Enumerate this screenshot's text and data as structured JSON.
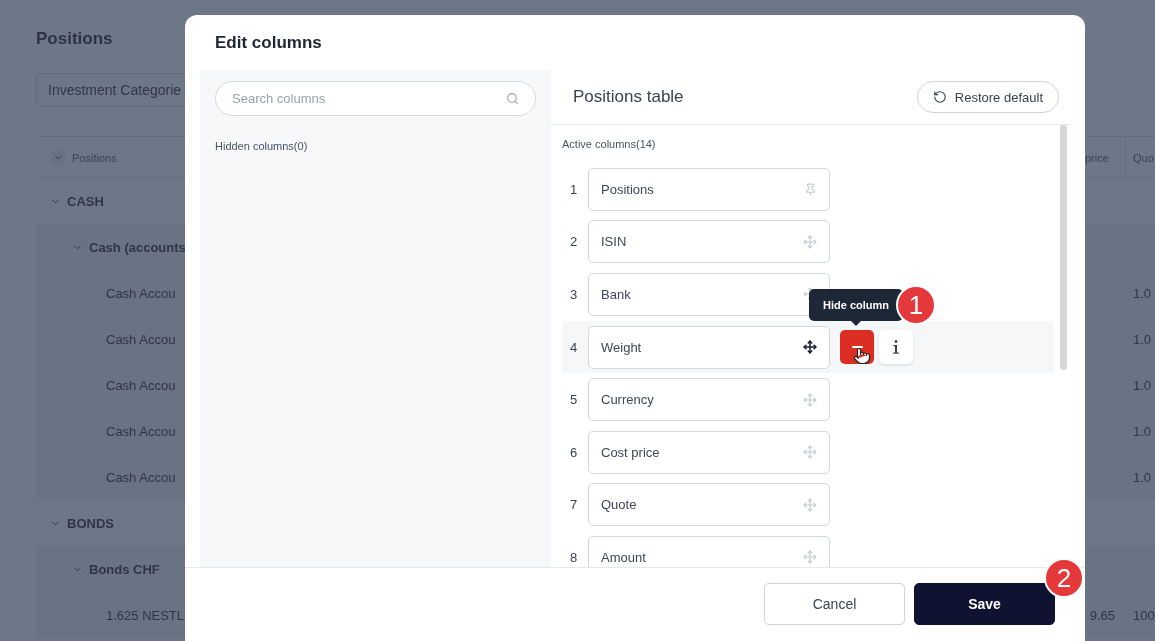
{
  "background": {
    "title": "Positions",
    "filter": "Investment Categorie",
    "table": {
      "columns": [
        {
          "label": "Positions"
        },
        {
          "label": "price"
        },
        {
          "label": "Quo"
        }
      ],
      "rows": [
        {
          "label": "CASH",
          "expanded": true,
          "children": [
            {
              "label": "Cash (accounts",
              "expanded": true,
              "children": [
                {
                  "label": "Cash Accou",
                  "quote": "1.0"
                },
                {
                  "label": "Cash Accou",
                  "quote": "1.0"
                },
                {
                  "label": "Cash Accou",
                  "quote": "1.0"
                },
                {
                  "label": "Cash Accou",
                  "quote": "1.0"
                },
                {
                  "label": "Cash Accou",
                  "quote": "1.0"
                }
              ]
            }
          ]
        },
        {
          "label": "BONDS",
          "expanded": true,
          "children": [
            {
              "label": "Bonds CHF",
              "expanded": true,
              "children": [
                {
                  "label": "1.625 NESTL",
                  "price": "9.65",
                  "quote": "100"
                }
              ]
            }
          ]
        }
      ]
    }
  },
  "dialog": {
    "title": "Edit columns",
    "search": {
      "placeholder": "Search columns"
    },
    "hidden_label": "Hidden columns(0)",
    "panel_title": "Positions table",
    "restore_button": "Restore default",
    "active_label": "Active columns(14)",
    "columns": [
      {
        "number": "1",
        "label": "Positions",
        "kind": "pinned",
        "hovered": false
      },
      {
        "number": "2",
        "label": "ISIN",
        "kind": "movable",
        "hovered": false
      },
      {
        "number": "3",
        "label": "Bank",
        "kind": "movable",
        "hovered": false
      },
      {
        "number": "4",
        "label": "Weight",
        "kind": "movable",
        "hovered": true,
        "tooltip": "Hide column"
      },
      {
        "number": "5",
        "label": "Currency",
        "kind": "movable",
        "hovered": false
      },
      {
        "number": "6",
        "label": "Cost price",
        "kind": "movable",
        "hovered": false
      },
      {
        "number": "7",
        "label": "Quote",
        "kind": "movable",
        "hovered": false
      },
      {
        "number": "8",
        "label": "Amount",
        "kind": "movable",
        "hovered": false
      }
    ],
    "buttons": [
      {
        "label": "Cancel",
        "kind": "secondary"
      },
      {
        "label": "Save",
        "kind": "primary"
      }
    ]
  },
  "callouts": [
    {
      "label": "1"
    },
    {
      "label": "2"
    }
  ]
}
